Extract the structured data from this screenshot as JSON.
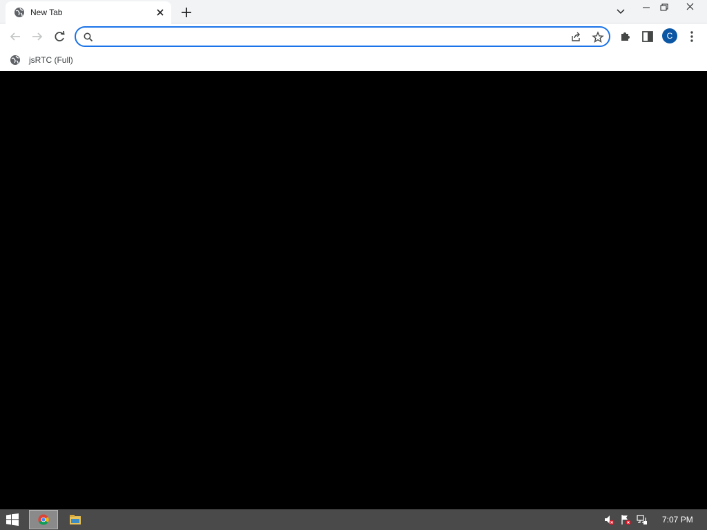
{
  "tab": {
    "title": "New Tab",
    "favicon": "globe-icon"
  },
  "window_controls": [
    "tab-search",
    "minimize",
    "restore",
    "close"
  ],
  "omnibox": {
    "value": "",
    "placeholder": ""
  },
  "profile": {
    "initial": "C",
    "color": "#0b57a4"
  },
  "bookmarks": [
    {
      "label": "jsRTC (Full)",
      "icon": "globe-icon"
    }
  ],
  "taskbar": {
    "clock": "7:07 PM",
    "pinned": [
      "chrome",
      "file-explorer"
    ],
    "tray": [
      "volume-muted-icon",
      "action-center-flag-icon",
      "network-icon"
    ]
  },
  "colors": {
    "accent": "#1a73e8",
    "close_hover": "#e81123",
    "taskbar": "#4a4a4a",
    "content": "#000000"
  }
}
